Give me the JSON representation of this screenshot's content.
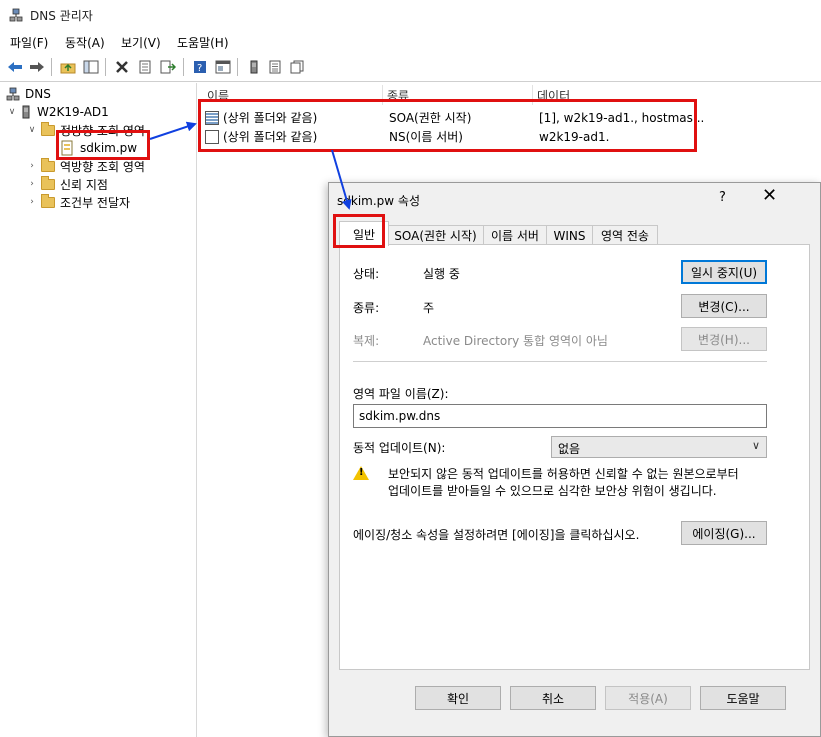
{
  "window": {
    "title": "DNS 관리자"
  },
  "menu": [
    "파일(F)",
    "동작(A)",
    "보기(V)",
    "도움말(H)"
  ],
  "toolbar": {
    "icons": [
      "back-icon",
      "forward-icon",
      "up-folder-icon",
      "show-hide-tree-icon",
      "delete-icon",
      "properties-icon",
      "export-icon",
      "help-icon",
      "console-icon",
      "server-icon",
      "list-icon",
      "copy-icon"
    ]
  },
  "tree": {
    "root": "DNS",
    "server": "W2K19-AD1",
    "forward_zones": "정방향 조회 영역",
    "zone": "sdkim.pw",
    "reverse_zones": "역방향 조회 영역",
    "trust_points": "신뢰 지점",
    "conditional_forwarders": "조건부 전달자"
  },
  "list": {
    "columns": [
      "이름",
      "종류",
      "데이터"
    ],
    "rows": [
      {
        "name": "(상위 폴더와 같음)",
        "type": "SOA(권한 시작)",
        "data": "[1], w2k19-ad1., hostmas..."
      },
      {
        "name": "(상위 폴더와 같음)",
        "type": "NS(이름 서버)",
        "data": "w2k19-ad1."
      }
    ]
  },
  "dialog": {
    "title": "sdkim.pw 속성",
    "help": "?",
    "close": "✕",
    "tabs": [
      "일반",
      "SOA(권한 시작)",
      "이름 서버",
      "WINS",
      "영역 전송"
    ],
    "status_label": "상태:",
    "status_value": "실행 중",
    "pause_button": "일시 중지(U)",
    "type_label": "종류:",
    "type_value": "주",
    "change_type_button": "변경(C)...",
    "replication_label": "복제:",
    "replication_value": "Active Directory 통합 영역이 아님",
    "change_replication_button": "변경(H)...",
    "zone_file_label": "영역 파일 이름(Z):",
    "zone_file_value": "sdkim.pw.dns",
    "dynamic_update_label": "동적 업데이트(N):",
    "dynamic_update_value": "없음",
    "warning_line1": "보안되지 않은 동적 업데이트를 허용하면 신뢰할 수 없는 원본으로부터",
    "warning_line2": "업데이트를 받아들일 수 있으므로 심각한 보안상 위험이 생깁니다.",
    "aging_text": "에이징/청소 속성을 설정하려면 [에이징]을 클릭하십시오.",
    "aging_button": "에이징(G)...",
    "ok": "확인",
    "cancel": "취소",
    "apply": "적용(A)",
    "helpbtn": "도움말"
  },
  "colors": {
    "annotation": "#e01010",
    "arrow": "#1040e0",
    "focus": "#0078d7"
  }
}
